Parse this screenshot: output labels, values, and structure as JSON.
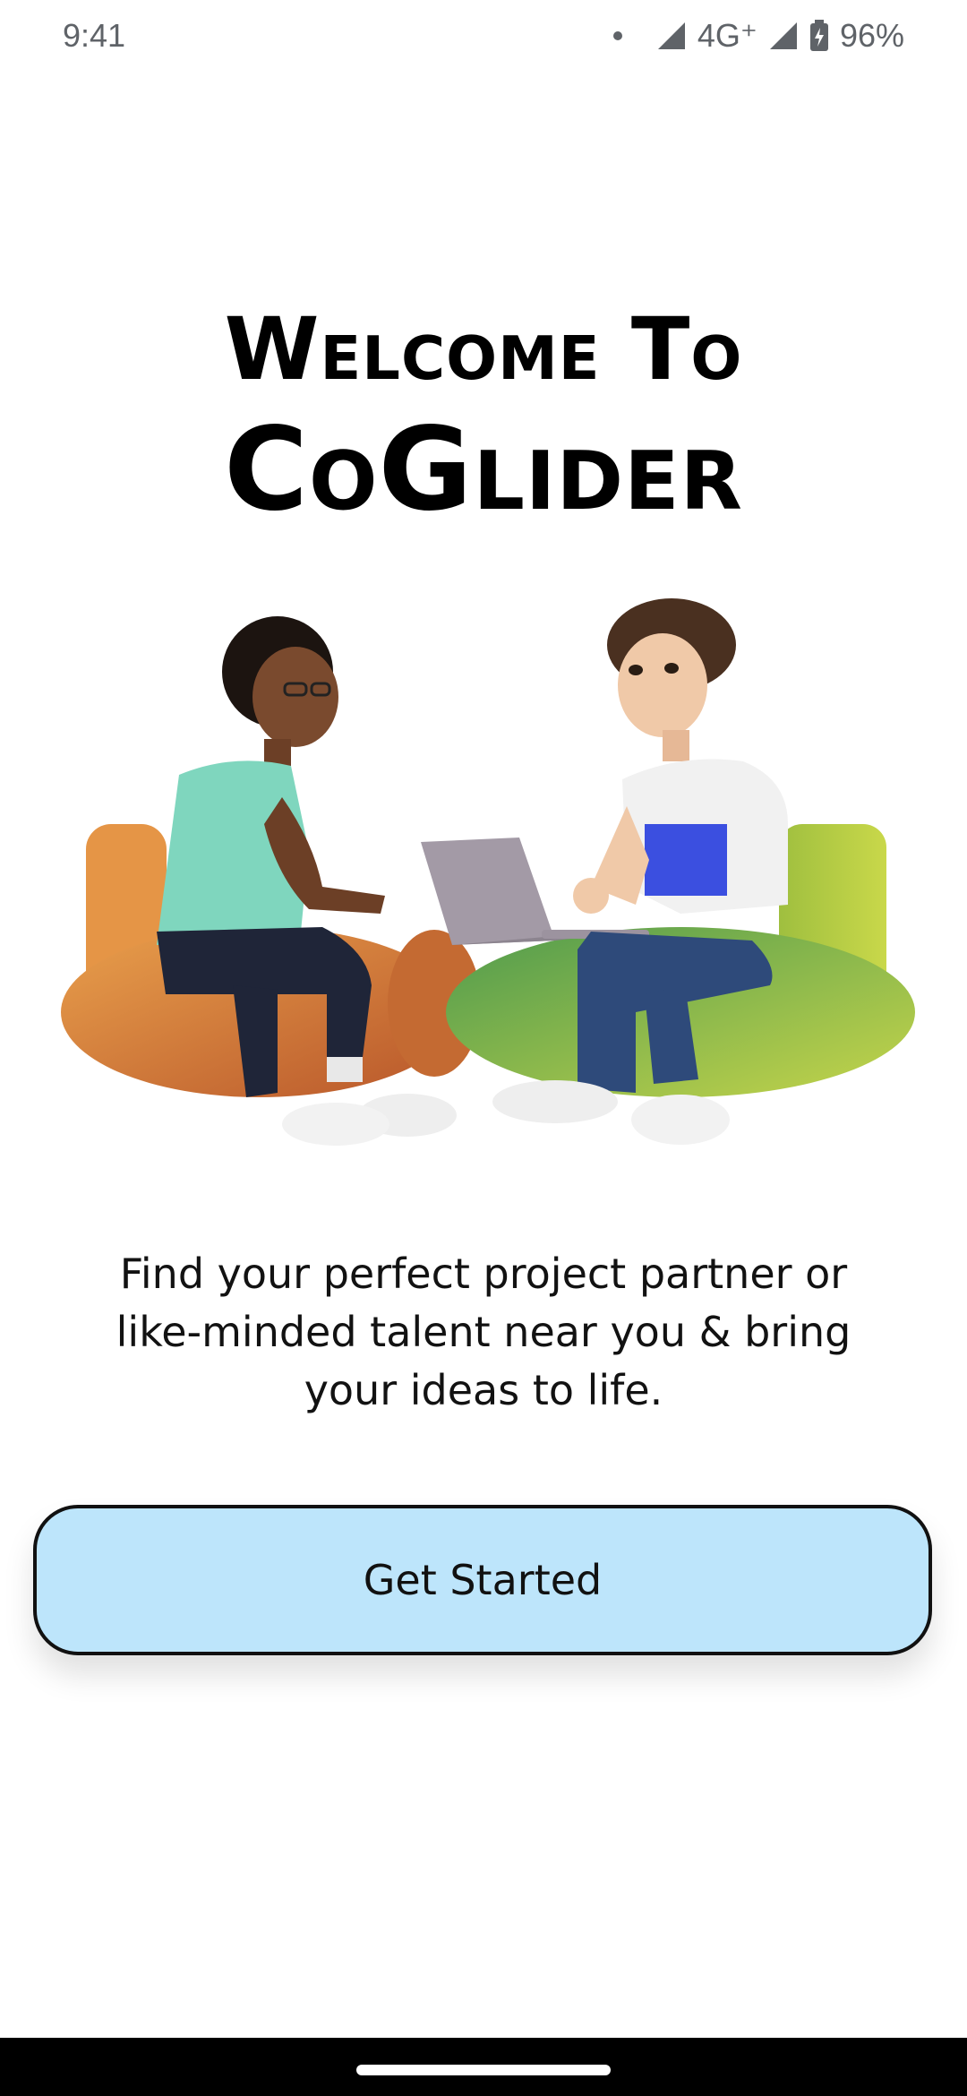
{
  "status_bar": {
    "time": "9:41",
    "network": "4G⁺",
    "battery": "96%"
  },
  "title": {
    "line1": "Welcome To",
    "line2": "CoGlider"
  },
  "subtitle": "Find your perfect project partner or like-minded talent near you & bring your ideas to life.",
  "cta": {
    "label": "Get Started"
  },
  "colors": {
    "cta_background": "#bde5fb",
    "cta_border": "#111111",
    "nav_bar": "#000000"
  },
  "icons": {
    "status": [
      "dot-icon",
      "signal-icon",
      "signal-icon",
      "battery-charging-icon"
    ]
  }
}
